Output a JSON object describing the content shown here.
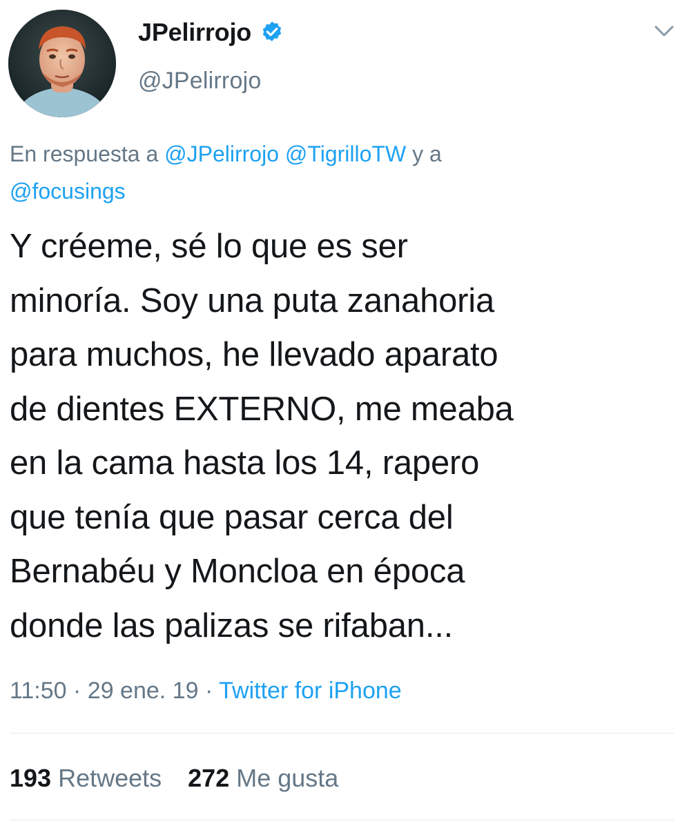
{
  "author": {
    "name": "JPelirrojo",
    "handle": "@JPelirrojo",
    "verified": true
  },
  "reply_context": {
    "prefix": "En respuesta a",
    "mentions": [
      "@JPelirrojo",
      "@TigrilloTW"
    ],
    "connector": "y a",
    "last_mention": "@focusings"
  },
  "tweet": {
    "lines": [
      "Y créeme, sé lo que es ser",
      "minoría. Soy una puta zanahoria",
      "para muchos, he llevado aparato",
      "de dientes EXTERNO, me meaba",
      "en la cama hasta los 14, rapero",
      "que tenía que pasar cerca del",
      "Bernabéu y Moncloa en época",
      "donde las palizas se rifaban..."
    ]
  },
  "meta": {
    "time": "11:50",
    "separator": "·",
    "date": "29 ene. 19",
    "source": "Twitter for iPhone"
  },
  "stats": {
    "retweets_count": "193",
    "retweets_label": "Retweets",
    "likes_count": "272",
    "likes_label": "Me gusta"
  },
  "icons": {
    "verified": "verified-badge-icon",
    "menu": "chevron-down-icon",
    "avatar": "profile-photo"
  },
  "colors": {
    "link": "#1da1f2",
    "secondary_text": "#657786",
    "primary_text": "#14171a",
    "divider": "#e1e8ed"
  }
}
